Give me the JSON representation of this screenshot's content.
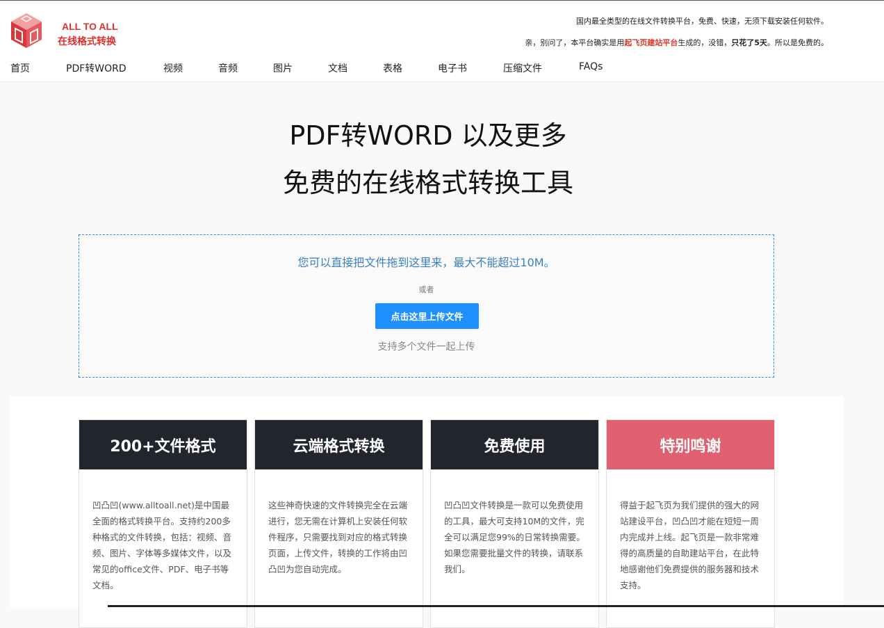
{
  "brand": {
    "name_en": "ALL TO ALL",
    "name_cn": "在线格式转换"
  },
  "header": {
    "tagline1": "国内最全类型的在线文件转换平台，免费、快速，无须下载安装任何软件。",
    "tagline2_a": "亲，别问了，本平台确实是用",
    "tagline2_link": "起飞页建站平台",
    "tagline2_b": "生成的，没错，",
    "tagline2_bold": "只花了5天",
    "tagline2_c": "。所以是免费的。"
  },
  "nav": [
    "首页",
    "PDF转WORD",
    "视频",
    "音频",
    "图片",
    "文档",
    "表格",
    "电子书",
    "压缩文件",
    "FAQs"
  ],
  "hero": {
    "line1": "PDF转WORD 以及更多",
    "line2": "免费的在线格式转换工具"
  },
  "upload": {
    "drop_text": "您可以直接把文件拖到这里来，最大不能超过10M。",
    "or_text": "或者",
    "button_label": "点击这里上传文件",
    "multi_text": "支持多个文件一起上传"
  },
  "features": [
    {
      "title": "200+文件格式",
      "text": "凹凸凹(www.alltoall.net)是中国最全面的格式转换平台。支持约200多种格式的文件转换，包括：视频、音频、图片、字体等多媒体文件，以及常见的office文件、PDF、电子书等文档。"
    },
    {
      "title": "云端格式转换",
      "text": "这些神奇快速的文件转换完全在云端进行，您无需在计算机上安装任何软件程序，只需要找到对应的格式转换页面，上传文件，转换的工作将由凹凸凹为您自动完成。"
    },
    {
      "title": "免费使用",
      "text": "凹凸凹文件转换是一款可以免费使用的工具，最大可支持10M的文件，完全可以满足您99%的日常转换需要。如果您需要批量文件的转换，请联系我们。"
    },
    {
      "title": "特别鸣谢",
      "text": "得益于起飞页为我们提供的强大的网站建设平台，凹凸凹才能在短短一周内完成并上线。起飞页是一款非常难得的高质量的自助建站平台，在此特地感谢他们免费提供的服务器和技术支持。"
    }
  ],
  "colors": {
    "brand_red": "#e0302e",
    "upload_blue": "#1e90ff",
    "card_dark": "#22252d",
    "card_pink": "#e06070"
  }
}
